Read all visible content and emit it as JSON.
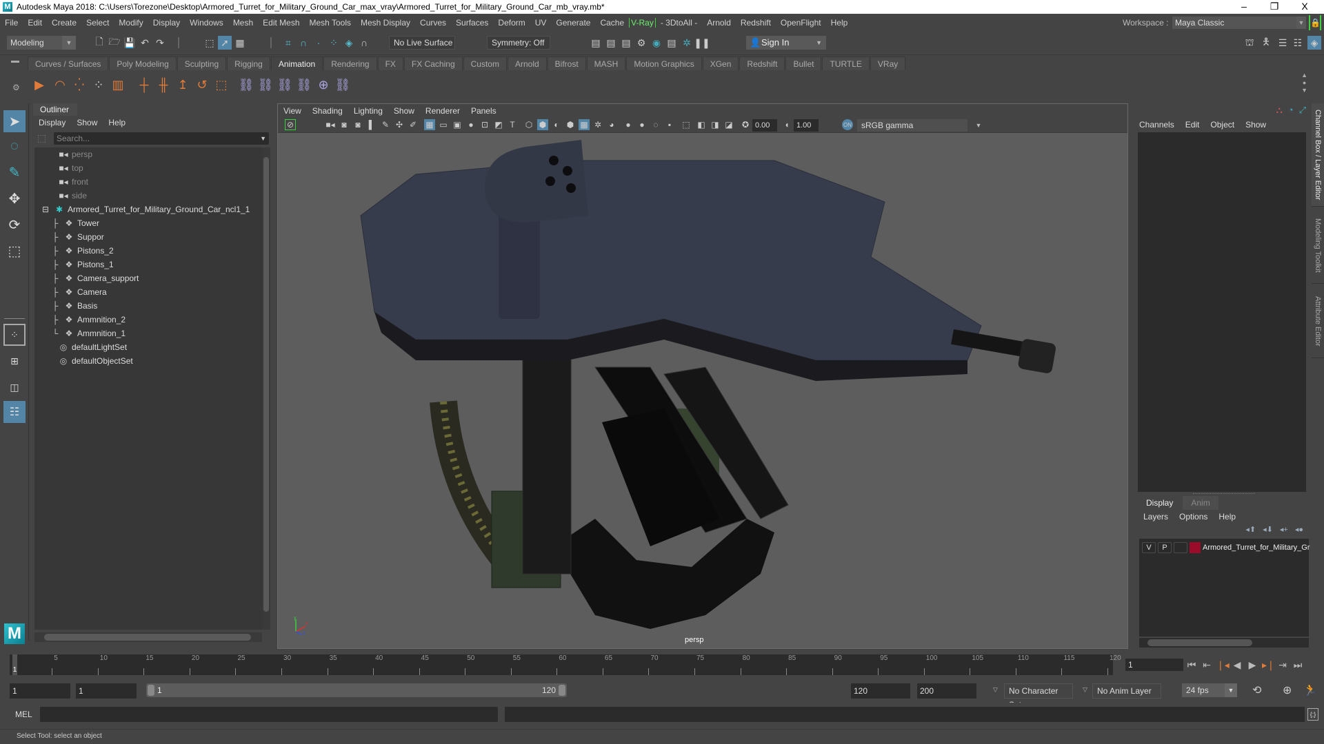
{
  "window": {
    "title": "Autodesk Maya 2018: C:\\Users\\Torezone\\Desktop\\Armored_Turret_for_Military_Ground_Car_max_vray\\Armored_Turret_for_Military_Ground_Car_mb_vray.mb*",
    "minimize": "–",
    "maximize": "❐",
    "close": "X"
  },
  "menubar": {
    "items": [
      "File",
      "Edit",
      "Create",
      "Select",
      "Modify",
      "Display",
      "Windows",
      "Mesh",
      "Edit Mesh",
      "Mesh Tools",
      "Mesh Display",
      "Curves",
      "Surfaces",
      "Deform",
      "UV",
      "Generate",
      "Cache"
    ],
    "vray": "V-Ray",
    "items2": [
      "- 3DtoAll -",
      "Arnold",
      "Redshift",
      "OpenFlight",
      "Help"
    ],
    "workspace_label": "Workspace :",
    "workspace_value": "Maya Classic"
  },
  "statusline": {
    "mode": "Modeling",
    "live_surface": "No Live Surface",
    "symmetry": "Symmetry: Off",
    "sign_in": "Sign In"
  },
  "shelf": {
    "tabs": [
      "Curves / Surfaces",
      "Poly Modeling",
      "Sculpting",
      "Rigging",
      "Animation",
      "Rendering",
      "FX",
      "FX Caching",
      "Custom",
      "Arnold",
      "Bifrost",
      "MASH",
      "Motion Graphics",
      "XGen",
      "Redshift",
      "Bullet",
      "TURTLE",
      "VRay"
    ],
    "active_tab": "Animation"
  },
  "outliner": {
    "tab": "Outliner",
    "menu": [
      "Display",
      "Show",
      "Help"
    ],
    "search_placeholder": "Search...",
    "cameras": [
      "persp",
      "top",
      "front",
      "side"
    ],
    "group": "Armored_Turret_for_Military_Ground_Car_ncl1_1",
    "children": [
      "Tower",
      "Suppor",
      "Pistons_2",
      "Pistons_1",
      "Camera_support",
      "Camera",
      "Basis",
      "Ammnition_2",
      "Ammnition_1"
    ],
    "sets": [
      "defaultLightSet",
      "defaultObjectSet"
    ]
  },
  "viewport": {
    "menu": [
      "View",
      "Shading",
      "Lighting",
      "Show",
      "Renderer",
      "Panels"
    ],
    "exposure": "0.00",
    "gamma": "1.00",
    "color_space": "sRGB gamma",
    "camera_label": "persp"
  },
  "channelbox": {
    "menu": [
      "Channels",
      "Edit",
      "Object",
      "Show"
    ],
    "layer_tabs": [
      "Display",
      "Anim"
    ],
    "layer_menu": [
      "Layers",
      "Options",
      "Help"
    ],
    "layer": {
      "v": "V",
      "p": "P",
      "name": "Armored_Turret_for_Military_Ground_Car",
      "color": "#9b0b2a"
    }
  },
  "sidetabs": [
    "Channel Box / Layer Editor",
    "Modeling Toolkit",
    "Attribute Editor"
  ],
  "timeline": {
    "ticks": [
      5,
      10,
      15,
      20,
      25,
      30,
      35,
      40,
      45,
      50,
      55,
      60,
      65,
      70,
      75,
      80,
      85,
      90,
      95,
      100,
      105,
      110,
      115,
      120
    ],
    "current_frame": "1",
    "current_frame_field": "1",
    "range_start": "1",
    "range_inner_start": "1",
    "slider_start": "1",
    "slider_end": "120",
    "range_end": "120",
    "anim_end": "200",
    "character_set": "No Character Set",
    "anim_layer": "No Anim Layer",
    "fps": "24 fps"
  },
  "cmdline": {
    "label": "MEL"
  },
  "helpline": {
    "text": "Select Tool: select an object"
  }
}
